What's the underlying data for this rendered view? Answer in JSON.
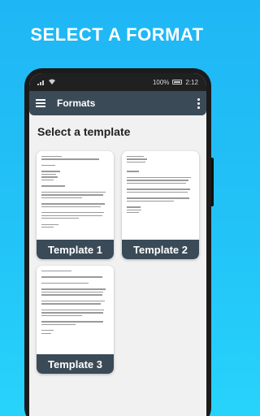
{
  "promo": {
    "title": "SELECT A FORMAT"
  },
  "statusbar": {
    "battery": "100%",
    "time": "2:12"
  },
  "appbar": {
    "title": "Formats"
  },
  "main": {
    "section_title": "Select a template",
    "templates": [
      {
        "label": "Template 1"
      },
      {
        "label": "Template 2"
      },
      {
        "label": "Template 3"
      }
    ]
  },
  "colors": {
    "background": "#22c3f7",
    "appbar": "#3a4a57",
    "card_label": "#3a4a57"
  },
  "icons": [
    "menu-icon",
    "more-vert-icon",
    "wifi-icon",
    "battery-icon"
  ]
}
